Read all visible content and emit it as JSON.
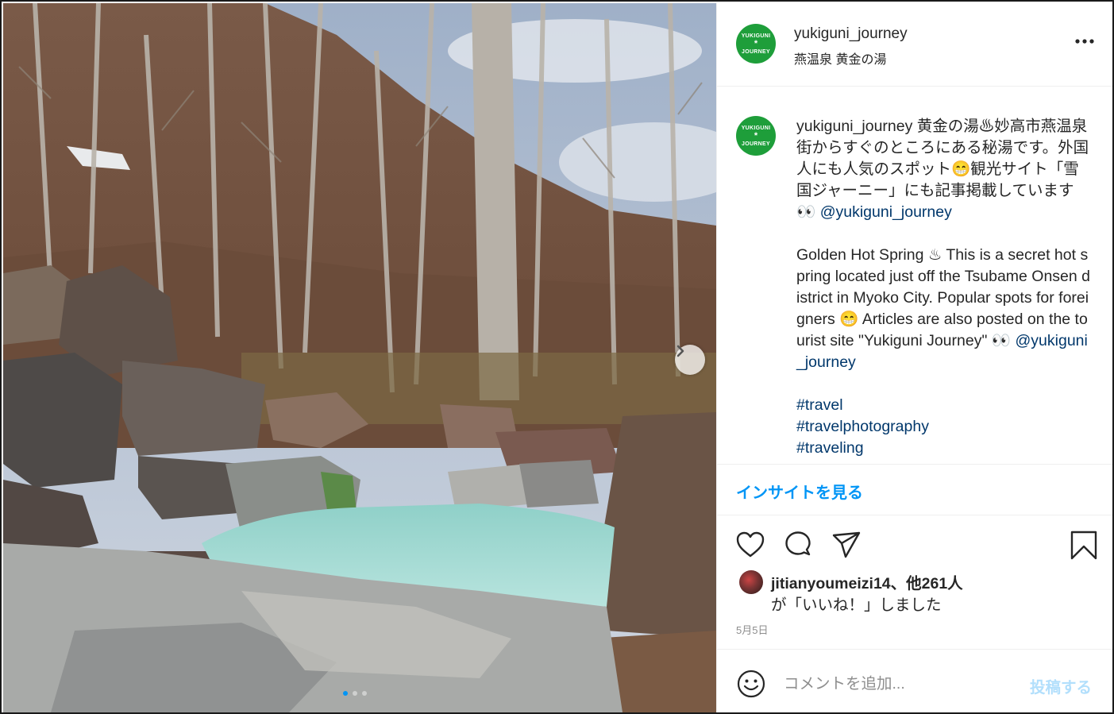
{
  "post": {
    "username": "yukiguni_journey",
    "location": "燕温泉 黄金の湯",
    "avatar_text": [
      "YUKIGUNI",
      "*",
      "JOURNEY"
    ],
    "more_icon": "more-horizontal-icon"
  },
  "photo": {
    "next_icon": "chevron-right-icon",
    "carousel_dots": 3,
    "active_dot": 0
  },
  "caption": {
    "username": "yukiguni_journey",
    "jp_text": "黄金の湯♨妙高市燕温泉街からすぐのところにある秘湯です。外国人にも人気のスポット😁観光サイト「雪国ジャーニー」にも記事掲載しています👀",
    "jp_mention": "@yukiguni_journey",
    "en_text": "Golden Hot Spring ♨ This is a secret hot spring located just off the Tsubame Onsen district in Myoko City. Popular spots for foreigners 😁 Articles are also posted on the tourist site \"Yukiguni Journey\" 👀",
    "en_mention": "@yukiguni_journey",
    "hashtags": [
      "#travel",
      "#travelphotography",
      "#traveling"
    ]
  },
  "insight_label": "インサイトを見る",
  "actions": {
    "like_icon": "heart-icon",
    "comment_icon": "comment-icon",
    "share_icon": "send-icon",
    "save_icon": "bookmark-icon"
  },
  "likes": {
    "user": "jitianyoumeizi14",
    "others": "、他261人",
    "suffix": "が「いいね！」しました"
  },
  "date": "5月5日",
  "comment": {
    "placeholder": "コメントを追加...",
    "post_label": "投稿する",
    "emoji_icon": "smile-icon"
  },
  "colors": {
    "accent": "#0095f6",
    "link": "#00376b",
    "post_disabled": "#b2dffc",
    "avatar_green": "#1e9e3a"
  }
}
